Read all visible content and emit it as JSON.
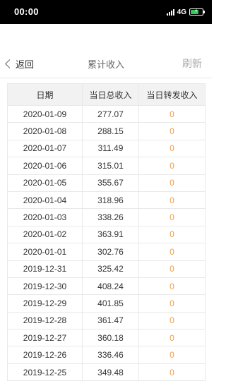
{
  "status_bar": {
    "time": "00:00",
    "network": "4G",
    "battery_color": "#35c759",
    "battery_level": 0.7
  },
  "nav": {
    "back_label": "返回",
    "title": "累计收入",
    "refresh_label": "刷新"
  },
  "table": {
    "headers": [
      "日期",
      "当日总收入",
      "当日转发收入"
    ],
    "rows": [
      [
        "2020-01-09",
        "277.07",
        "0"
      ],
      [
        "2020-01-08",
        "288.15",
        "0"
      ],
      [
        "2020-01-07",
        "311.49",
        "0"
      ],
      [
        "2020-01-06",
        "315.01",
        "0"
      ],
      [
        "2020-01-05",
        "355.67",
        "0"
      ],
      [
        "2020-01-04",
        "318.96",
        "0"
      ],
      [
        "2020-01-03",
        "338.26",
        "0"
      ],
      [
        "2020-01-02",
        "363.91",
        "0"
      ],
      [
        "2020-01-01",
        "302.76",
        "0"
      ],
      [
        "2019-12-31",
        "325.42",
        "0"
      ],
      [
        "2019-12-30",
        "408.24",
        "0"
      ],
      [
        "2019-12-29",
        "401.85",
        "0"
      ],
      [
        "2019-12-28",
        "361.47",
        "0"
      ],
      [
        "2019-12-27",
        "360.18",
        "0"
      ],
      [
        "2019-12-26",
        "336.46",
        "0"
      ],
      [
        "2019-12-25",
        "349.48",
        "0"
      ]
    ]
  },
  "colors": {
    "accent_zero": "#f0a04b",
    "header_bg": "#f2f2f2"
  }
}
